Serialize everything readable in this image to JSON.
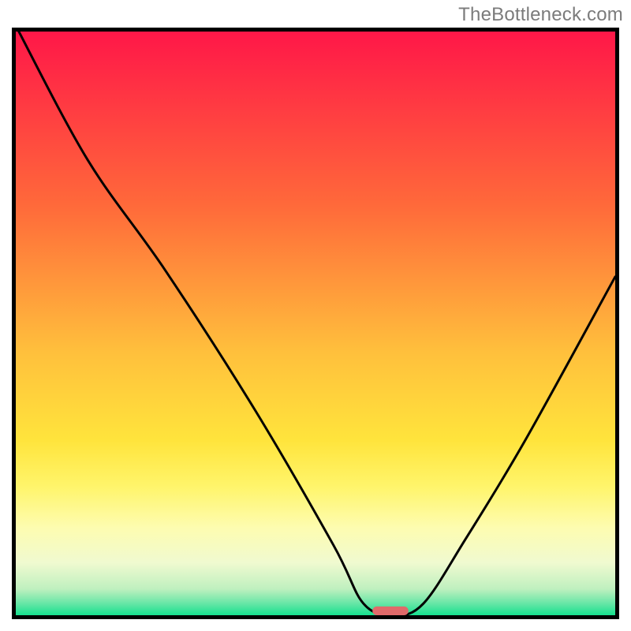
{
  "watermark": "TheBottleneck.com",
  "chart_data": {
    "type": "line",
    "title": "",
    "xlabel": "",
    "ylabel": "",
    "xlim": [
      0,
      100
    ],
    "ylim": [
      0,
      100
    ],
    "gradient_stops": [
      {
        "offset": 0,
        "color": "#ff1748"
      },
      {
        "offset": 0.3,
        "color": "#ff6a3a"
      },
      {
        "offset": 0.55,
        "color": "#ffc03c"
      },
      {
        "offset": 0.7,
        "color": "#ffe43c"
      },
      {
        "offset": 0.78,
        "color": "#fff56b"
      },
      {
        "offset": 0.85,
        "color": "#fdfcb0"
      },
      {
        "offset": 0.91,
        "color": "#f0fad0"
      },
      {
        "offset": 0.955,
        "color": "#bff0bf"
      },
      {
        "offset": 0.98,
        "color": "#66e6a6"
      },
      {
        "offset": 1.0,
        "color": "#16e08f"
      }
    ],
    "series": [
      {
        "name": "bottleneck-curve",
        "x": [
          0,
          12,
          25,
          40,
          53,
          58,
          63,
          68,
          75,
          85,
          100
        ],
        "values": [
          101,
          78,
          59,
          35,
          12,
          2,
          0,
          2,
          13,
          30,
          58
        ]
      }
    ],
    "marker": {
      "x": 62.5,
      "y": 0,
      "width": 6,
      "height": 1.5,
      "name": "optimal-region"
    },
    "annotations": []
  }
}
